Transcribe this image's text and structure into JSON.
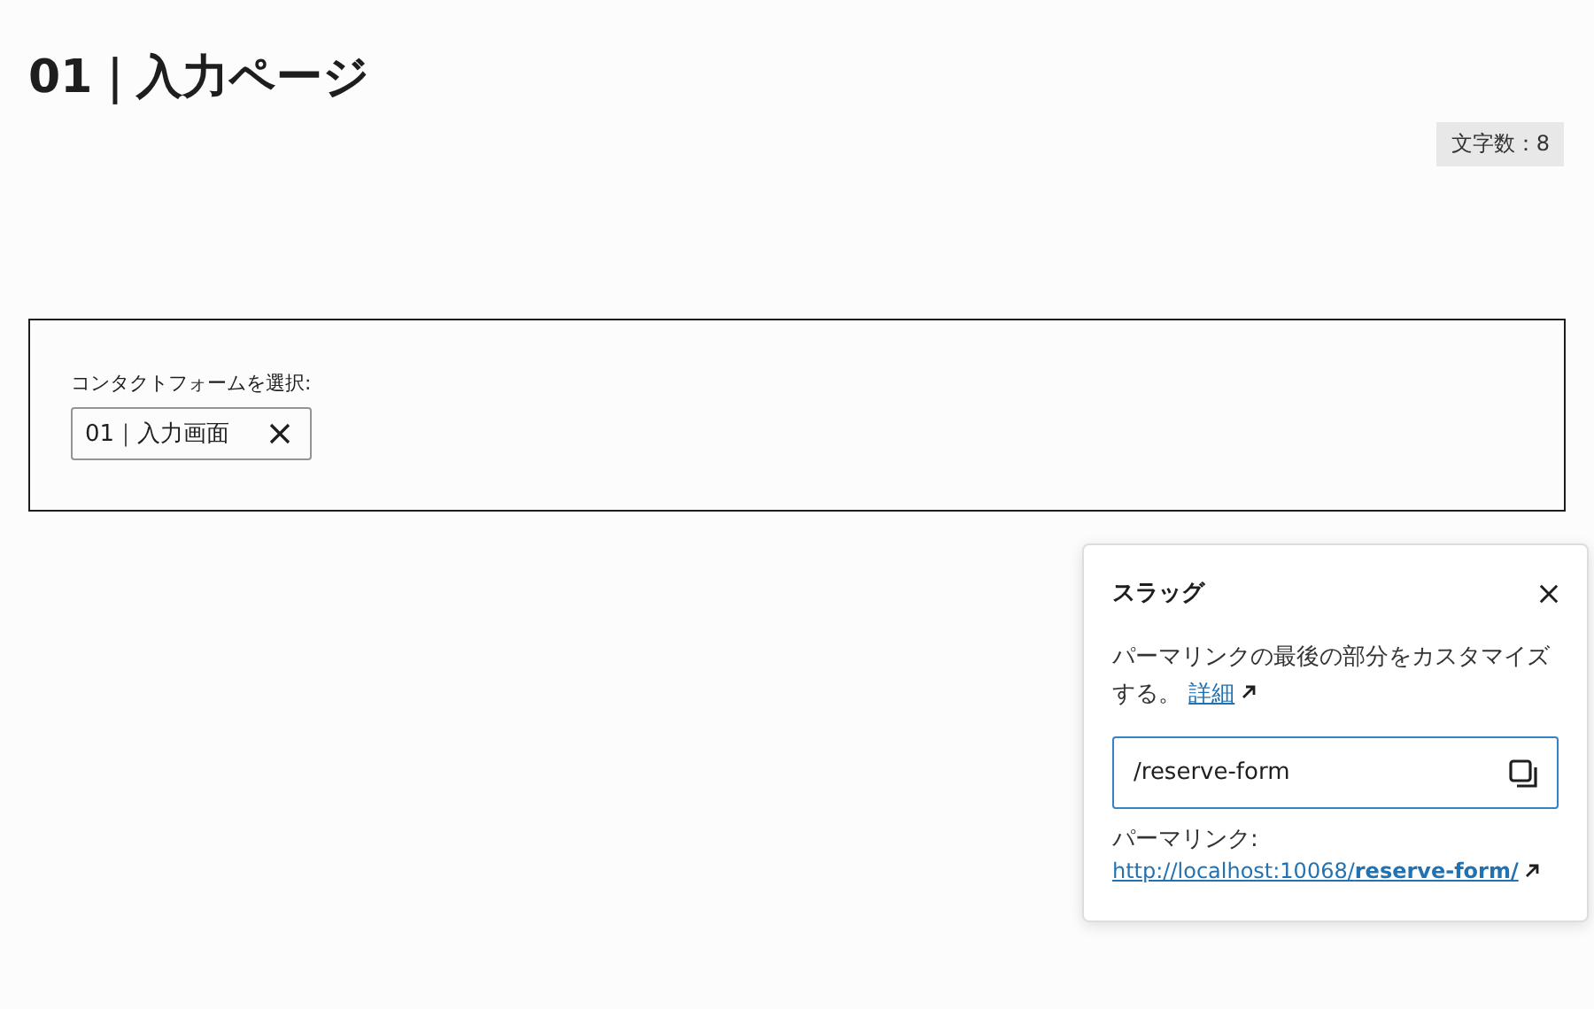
{
  "page_title": "01｜入力ページ",
  "char_count": "文字数：8",
  "contact_form_block": {
    "label": "コンタクトフォームを選択:",
    "selected_form": "01｜入力画面"
  },
  "slug_popover": {
    "title": "スラッグ",
    "description": "パーマリンクの最後の部分をカスタマイズする。",
    "details_link": "詳細",
    "slug_value": "/reserve-form",
    "permalink_label": "パーマリンク:",
    "permalink_url": "http://localhost:10068/**reserve-form/**"
  }
}
